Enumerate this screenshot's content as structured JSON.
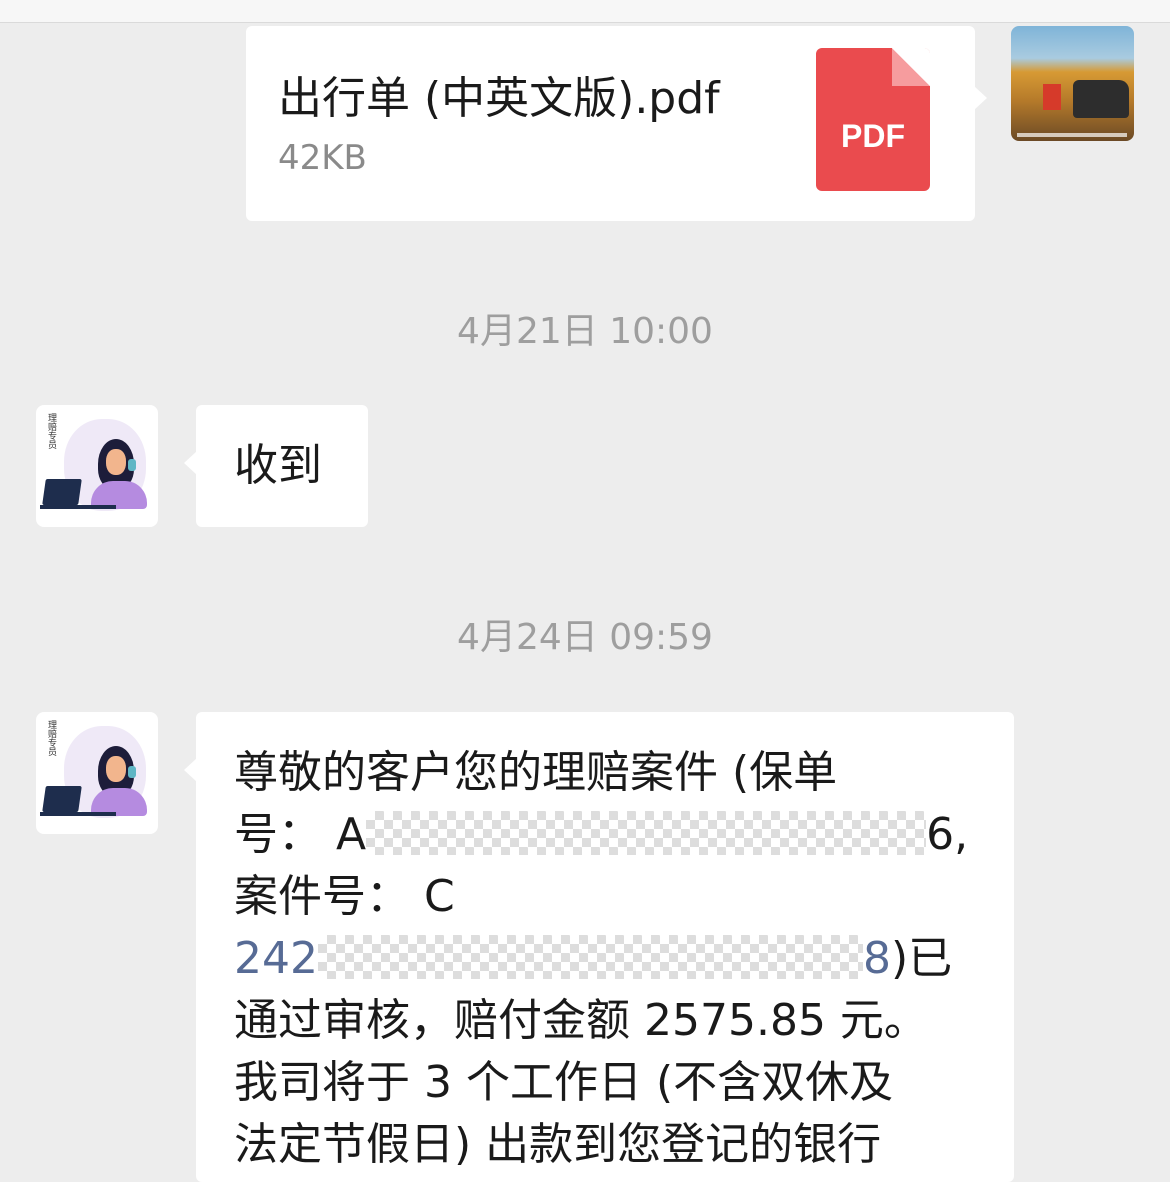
{
  "messages": {
    "file_message": {
      "file_name": "出行单 (中英文版).pdf",
      "file_size": "42KB",
      "file_type_label": "PDF"
    },
    "timestamp_1": "4月21日 10:00",
    "reply_1": "收到",
    "timestamp_2": "4月24日 09:59",
    "reply_2": {
      "line1": "尊敬的客户您的理赔案件 (保单",
      "line2_prefix": "号：  A",
      "line2_suffix": "6,",
      "line3": "案件号：  C",
      "line4_prefix": "242",
      "line4_suffix": "8",
      "line4_after": ")已",
      "line5": "通过审核，赔付金额 2575.85 元。",
      "line6": "我司将于 3 个工作日 (不含双休及",
      "line7": "法定节假日) 出款到您登记的银行"
    }
  },
  "avatars": {
    "agent_badge": "理赔专员"
  },
  "colors": {
    "background": "#ededed",
    "bubble": "#ffffff",
    "pdf_red": "#ea4b4e",
    "link": "#576b95",
    "timestamp": "#9e9e9e"
  }
}
